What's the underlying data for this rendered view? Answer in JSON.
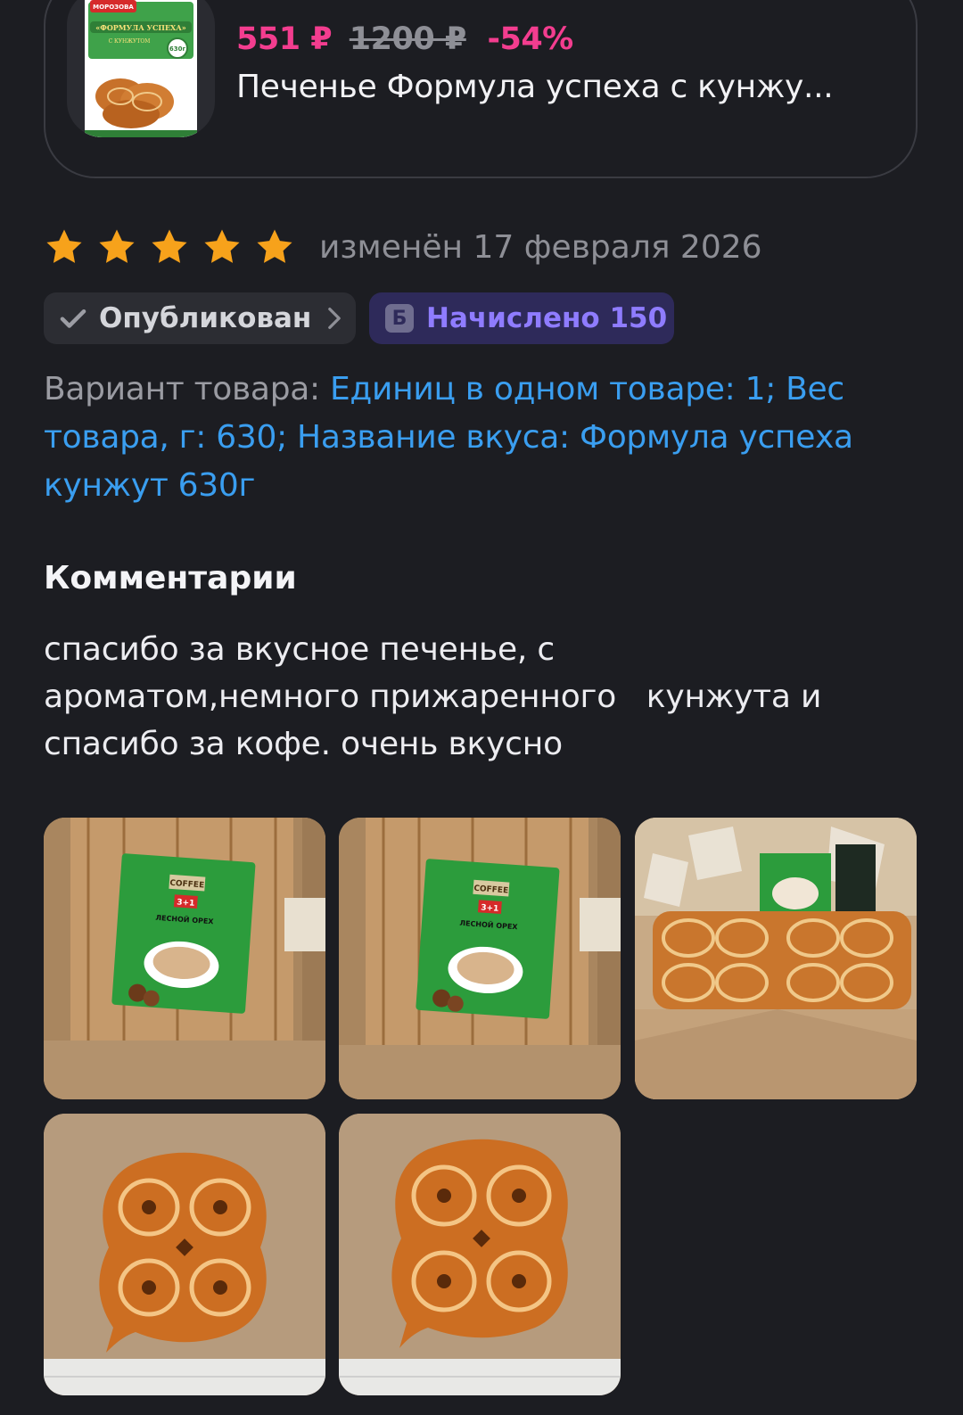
{
  "product": {
    "price_new": "551 ₽",
    "price_old": "1200 ₽",
    "discount": "-54%",
    "name": "Печенье Формула успеха с кунжу...",
    "package": {
      "brand": "МОРОЗОВА",
      "title": "«ФОРМУЛА УСПЕХА»",
      "subtitle": "С КУНЖУТОМ",
      "weight": "630г"
    }
  },
  "review": {
    "rating": 5,
    "max_rating": 5,
    "edited": "изменён 17 февраля 2026",
    "star_color": "#f7a21b"
  },
  "badges": {
    "published": "Опубликован",
    "bonus_icon": "Б",
    "bonus": "Начислено 150"
  },
  "variant": {
    "label": "Вариант товара: ",
    "value": "Единиц в одном товаре: 1; Вес товара, г: 630; Название вкуса: Формула успеха кунжут 630г"
  },
  "comments": {
    "heading": "Комментарии",
    "text": "спасибо за вкусное печенье, с\nароматом,немного прижаренного   кунжута и\nспасибо за кофе. очень вкусно"
  },
  "photos": {
    "coffee_pack": {
      "brand": "COFFEE",
      "badge": "3+1",
      "flavor": "ЛЕСНОЙ ОРЕХ"
    }
  },
  "colors": {
    "background": "#1c1d22",
    "accent_pink": "#f33d8f",
    "link_blue": "#3a9ef0",
    "bonus_purple": "#8f7cff"
  }
}
